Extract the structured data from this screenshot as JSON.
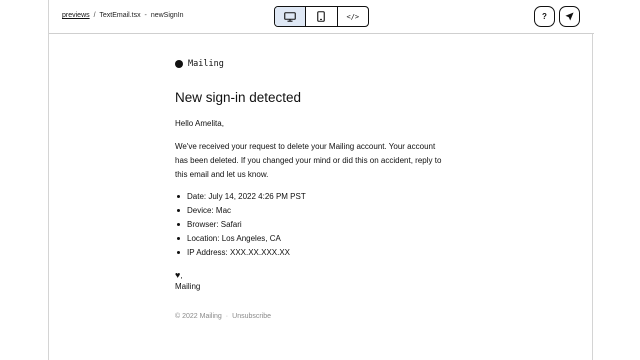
{
  "header": {
    "breadcrumb": {
      "root": "previews",
      "separator": "/",
      "file": "TextEmail.tsx",
      "component_separator": "-",
      "component": "newSignIn"
    },
    "view_modes": [
      "desktop",
      "mobile",
      "code"
    ],
    "active_view": "desktop",
    "code_label": "</>",
    "help_label": "?"
  },
  "email": {
    "brand": "Mailing",
    "title": "New sign-in detected",
    "greeting": "Hello Amelita,",
    "body": "We've received your request to delete your Mailing account. Your account has been deleted. If you changed your mind or did this on accident, reply to this email and let us know.",
    "details": [
      "Date: July 14, 2022 4:26 PM PST",
      "Device: Mac",
      "Browser: Safari",
      "Location: Los Angeles, CA",
      "IP Address: XXX.XX.XXX.XX"
    ],
    "signoff_heart": "♥",
    "signoff_comma": ",",
    "signature": "Mailing",
    "footer": {
      "copyright": "© 2022 Mailing",
      "divider": "·",
      "unsubscribe": "Unsubscribe"
    }
  },
  "colors": {
    "active_toggle_bg": "#dfe8f5",
    "border": "#111111",
    "footer_text": "#8a8a8a"
  }
}
